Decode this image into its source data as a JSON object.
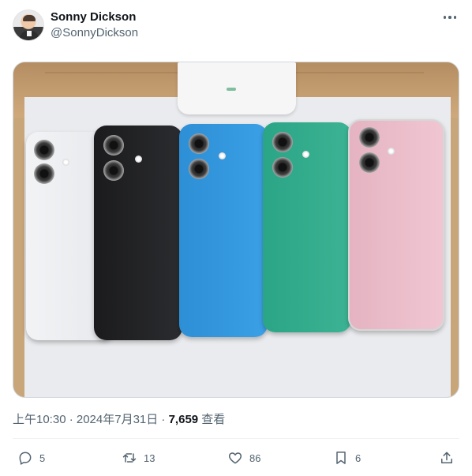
{
  "tweet": {
    "author_name": "Sonny Dickson",
    "author_handle": "@SonnyDickson",
    "timestamp": "上午10:30 · 2024年7月31日 · ",
    "views_count": "7,659",
    "views_label": " 查看",
    "image_alt_icon": "photo-of-five-phones"
  },
  "actions": {
    "reply_count": "5",
    "retweet_count": "13",
    "like_count": "86",
    "bookmark_count": "6"
  },
  "colors": {
    "text_primary": "#0f1419",
    "text_secondary": "#536471",
    "phone_white": "#f2f3f5",
    "phone_black": "#1b1b1d",
    "phone_blue": "#2d8fd6",
    "phone_teal": "#2aa585",
    "phone_pink": "#f0c6d2"
  }
}
